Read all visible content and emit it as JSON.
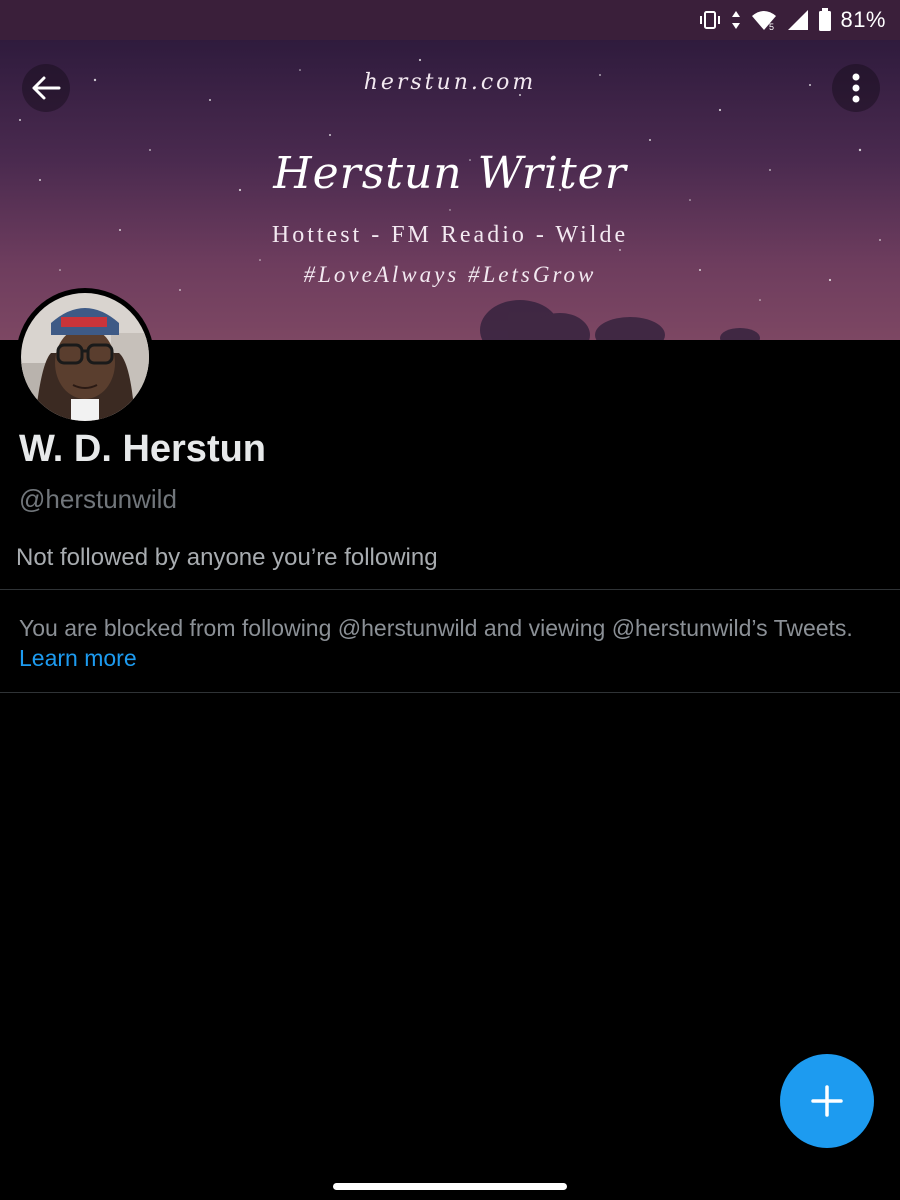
{
  "status_bar": {
    "battery_percent": "81%",
    "icons": [
      "vibrate-icon",
      "data-arrows-icon",
      "wifi-icon",
      "signal-icon",
      "battery-icon"
    ]
  },
  "banner": {
    "site": "herstun.com",
    "title": "Herstun Writer",
    "subtitle_line1": "Hottest - FM Readio - Wilde",
    "subtitle_line2": "#LoveAlways #LetsGrow"
  },
  "header": {
    "back_icon": "arrow-left-icon",
    "more_icon": "more-vertical-icon"
  },
  "profile": {
    "display_name": "W. D. Herstun",
    "handle": "@herstunwild",
    "followed_info": "Not followed by anyone you’re following"
  },
  "blocked_notice": {
    "message": "You are blocked from following @herstunwild and viewing @herstunwild’s Tweets.",
    "learn_more": "Learn more"
  },
  "fab": {
    "icon": "plus-icon"
  },
  "colors": {
    "accent": "#1d9bf0",
    "background": "#000000",
    "status_bar": "#3a1f3a",
    "secondary_text": "#71767b"
  }
}
